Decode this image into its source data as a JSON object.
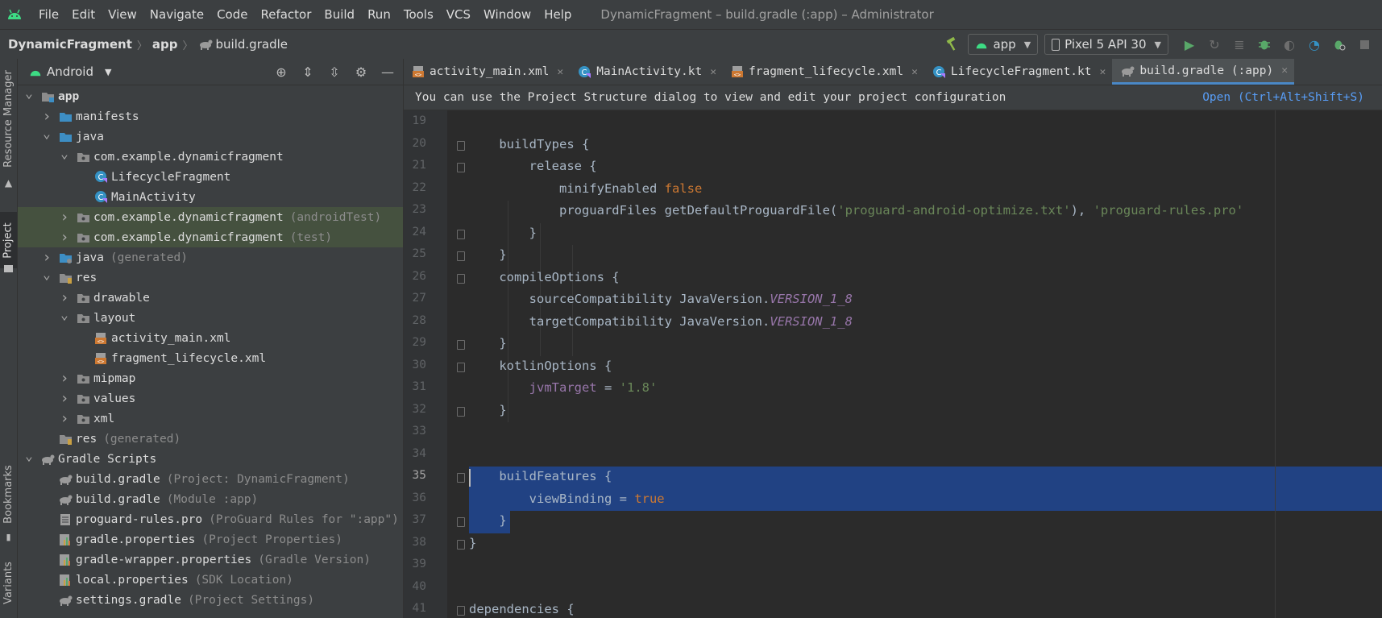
{
  "menubar": {
    "items": [
      "File",
      "Edit",
      "View",
      "Navigate",
      "Code",
      "Refactor",
      "Build",
      "Run",
      "Tools",
      "VCS",
      "Window",
      "Help"
    ],
    "title": "DynamicFragment – build.gradle (:app) – Administrator"
  },
  "breadcrumb": {
    "project": "DynamicFragment",
    "module": "app",
    "file": "build.gradle"
  },
  "toolbar": {
    "config": "app",
    "device": "Pixel 5 API 30"
  },
  "tool_windows": {
    "resource_manager": "Resource Manager",
    "project": "Project",
    "bookmarks": "Bookmarks",
    "variants": "Variants"
  },
  "project_panel": {
    "view": "Android",
    "tree": [
      {
        "label": "app",
        "hint": "",
        "icon": "module-folder-icon",
        "bold": true
      },
      {
        "label": "manifests",
        "hint": "",
        "icon": "folder-icon"
      },
      {
        "label": "java",
        "hint": "",
        "icon": "folder-icon"
      },
      {
        "label": "com.example.dynamicfragment",
        "hint": "",
        "icon": "package-icon"
      },
      {
        "label": "LifecycleFragment",
        "hint": "",
        "icon": "kotlin-class-icon"
      },
      {
        "label": "MainActivity",
        "hint": "",
        "icon": "kotlin-class-icon"
      },
      {
        "label": "com.example.dynamicfragment",
        "hint": "(androidTest)",
        "icon": "package-icon"
      },
      {
        "label": "com.example.dynamicfragment",
        "hint": "(test)",
        "icon": "package-icon"
      },
      {
        "label": "java",
        "hint": "(generated)",
        "icon": "generated-folder-icon"
      },
      {
        "label": "res",
        "hint": "",
        "icon": "res-folder-icon"
      },
      {
        "label": "drawable",
        "hint": "",
        "icon": "package-icon"
      },
      {
        "label": "layout",
        "hint": "",
        "icon": "package-icon"
      },
      {
        "label": "activity_main.xml",
        "hint": "",
        "icon": "xml-layout-icon"
      },
      {
        "label": "fragment_lifecycle.xml",
        "hint": "",
        "icon": "xml-layout-icon"
      },
      {
        "label": "mipmap",
        "hint": "",
        "icon": "package-icon"
      },
      {
        "label": "values",
        "hint": "",
        "icon": "package-icon"
      },
      {
        "label": "xml",
        "hint": "",
        "icon": "package-icon"
      },
      {
        "label": "res",
        "hint": "(generated)",
        "icon": "res-folder-icon"
      },
      {
        "label": "Gradle Scripts",
        "hint": "",
        "icon": "gradle-icon"
      },
      {
        "label": "build.gradle",
        "hint": "(Project: DynamicFragment)",
        "icon": "gradle-icon"
      },
      {
        "label": "build.gradle",
        "hint": "(Module :app)",
        "icon": "gradle-icon"
      },
      {
        "label": "proguard-rules.pro",
        "hint": "(ProGuard Rules for \":app\")",
        "icon": "text-file-icon"
      },
      {
        "label": "gradle.properties",
        "hint": "(Project Properties)",
        "icon": "properties-file-icon"
      },
      {
        "label": "gradle-wrapper.properties",
        "hint": "(Gradle Version)",
        "icon": "properties-file-icon"
      },
      {
        "label": "local.properties",
        "hint": "(SDK Location)",
        "icon": "properties-file-icon"
      },
      {
        "label": "settings.gradle",
        "hint": "(Project Settings)",
        "icon": "gradle-icon"
      }
    ]
  },
  "tabs": [
    {
      "label": "activity_main.xml",
      "icon": "xml-layout-icon"
    },
    {
      "label": "MainActivity.kt",
      "icon": "kotlin-class-icon"
    },
    {
      "label": "fragment_lifecycle.xml",
      "icon": "xml-layout-icon"
    },
    {
      "label": "LifecycleFragment.kt",
      "icon": "kotlin-class-icon"
    },
    {
      "label": "build.gradle (:app)",
      "icon": "gradle-icon",
      "active": true
    }
  ],
  "banner": {
    "message": "You can use the Project Structure dialog to view and edit your project configuration",
    "link": "Open (Ctrl+Alt+Shift+S)"
  },
  "editor": {
    "current_line": 35,
    "selected_lines": [
      35,
      36,
      37
    ],
    "lines": [
      {
        "n": 19,
        "tokens": []
      },
      {
        "n": 20,
        "tokens": [
          [
            "t",
            "    buildTypes {"
          ]
        ]
      },
      {
        "n": 21,
        "tokens": [
          [
            "t",
            "        release {"
          ]
        ]
      },
      {
        "n": 22,
        "tokens": [
          [
            "t",
            "            minifyEnabled "
          ],
          [
            "kw",
            "false"
          ]
        ]
      },
      {
        "n": 23,
        "tokens": [
          [
            "t",
            "            proguardFiles getDefaultProguardFile("
          ],
          [
            "str",
            "'proguard-android-optimize.txt'"
          ],
          [
            "t",
            "), "
          ],
          [
            "str",
            "'proguard-rules.pro'"
          ]
        ]
      },
      {
        "n": 24,
        "tokens": [
          [
            "t",
            "        }"
          ]
        ]
      },
      {
        "n": 25,
        "tokens": [
          [
            "t",
            "    }"
          ]
        ]
      },
      {
        "n": 26,
        "tokens": [
          [
            "t",
            "    compileOptions {"
          ]
        ]
      },
      {
        "n": 27,
        "tokens": [
          [
            "t",
            "        sourceCompatibility JavaVersion."
          ],
          [
            "prop",
            "VERSION_1_8"
          ]
        ]
      },
      {
        "n": 28,
        "tokens": [
          [
            "t",
            "        targetCompatibility JavaVersion."
          ],
          [
            "prop",
            "VERSION_1_8"
          ]
        ]
      },
      {
        "n": 29,
        "tokens": [
          [
            "t",
            "    }"
          ]
        ]
      },
      {
        "n": 30,
        "tokens": [
          [
            "t",
            "    kotlinOptions {"
          ]
        ]
      },
      {
        "n": 31,
        "tokens": [
          [
            "t",
            "        "
          ],
          [
            "pv",
            "jvmTarget"
          ],
          [
            "t",
            " = "
          ],
          [
            "str",
            "'1.8'"
          ]
        ]
      },
      {
        "n": 32,
        "tokens": [
          [
            "t",
            "    }"
          ]
        ]
      },
      {
        "n": 33,
        "tokens": []
      },
      {
        "n": 34,
        "tokens": []
      },
      {
        "n": 35,
        "tokens": [
          [
            "t",
            "    buildFeatures {"
          ]
        ]
      },
      {
        "n": 36,
        "tokens": [
          [
            "t",
            "        viewBinding = "
          ],
          [
            "kw",
            "true"
          ]
        ]
      },
      {
        "n": 37,
        "tokens": [
          [
            "t",
            "    }"
          ]
        ]
      },
      {
        "n": 38,
        "tokens": [
          [
            "t",
            "}"
          ]
        ]
      },
      {
        "n": 39,
        "tokens": []
      },
      {
        "n": 40,
        "tokens": []
      },
      {
        "n": 41,
        "tokens": [
          [
            "t",
            "dependencies {"
          ]
        ]
      }
    ]
  },
  "colors": {
    "accent": "#4a88c7",
    "selection": "#214283",
    "keyword": "#cc7832",
    "string": "#6a8759",
    "property": "#9876aa"
  }
}
